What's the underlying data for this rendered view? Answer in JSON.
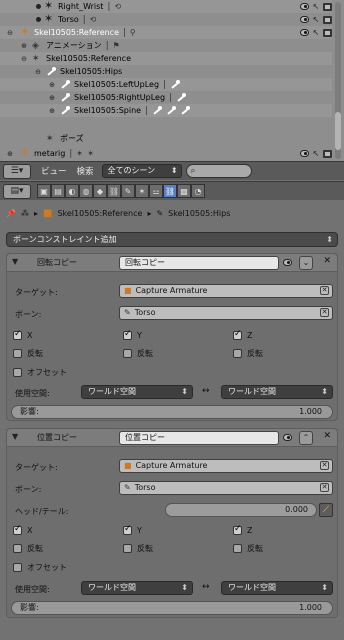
{
  "outliner": {
    "rows": [
      {
        "label": "Right_Wrist",
        "sep": "|"
      },
      {
        "label": "Torso",
        "sep": "|"
      },
      {
        "label": "Skel10505:Reference",
        "sep": "|"
      },
      {
        "label": "アニメーション",
        "sep": "|"
      },
      {
        "label": "Skel10505:Reference"
      },
      {
        "label": "Skel10505:Hips",
        "sep": "|"
      },
      {
        "label": "Skel10505:LeftUpLeg",
        "sep": "|"
      },
      {
        "label": "Skel10505:RightUpLeg",
        "sep": "|"
      },
      {
        "label": "Skel10505:Spine",
        "sep": "|"
      },
      {
        "label": "ポーズ"
      },
      {
        "label": "metarig",
        "sep": "|"
      }
    ],
    "scroll_position": 0.72
  },
  "outliner_header": {
    "menu_view": "ビュー",
    "menu_search": "検索",
    "display_mode": "全てのシーン",
    "search_placeholder": ""
  },
  "properties": {
    "breadcrumb": {
      "armature": "Skel10505:Reference",
      "bone": "Skel10505:Hips"
    },
    "add_constraint_label": "ボーンコンストレイント追加",
    "constraints": [
      {
        "type_label": "回転コピー",
        "name": "回転コピー",
        "target_label": "ターゲット:",
        "target_value": "Capture Armature",
        "bone_label": "ボーン:",
        "bone_value": "Torso",
        "axes": [
          {
            "label": "X",
            "checked": true
          },
          {
            "label": "Y",
            "checked": true
          },
          {
            "label": "Z",
            "checked": true
          }
        ],
        "invert": [
          {
            "label": "反転",
            "checked": false
          },
          {
            "label": "反転",
            "checked": false
          },
          {
            "label": "反転",
            "checked": false
          }
        ],
        "offset_label": "オフセット",
        "offset_checked": false,
        "space_label": "使用空間:",
        "owner_space": "ワールド空間",
        "target_space": "ワールド空間",
        "influence_label": "影響:",
        "influence_value": "1.000"
      },
      {
        "type_label": "位置コピー",
        "name": "位置コピー",
        "target_label": "ターゲット:",
        "target_value": "Capture Armature",
        "bone_label": "ボーン:",
        "bone_value": "Torso",
        "headtail_label": "ヘッド/テール:",
        "headtail_value": "0.000",
        "axes": [
          {
            "label": "X",
            "checked": true
          },
          {
            "label": "Y",
            "checked": true
          },
          {
            "label": "Z",
            "checked": true
          }
        ],
        "invert": [
          {
            "label": "反転",
            "checked": false
          },
          {
            "label": "反転",
            "checked": false
          },
          {
            "label": "反転",
            "checked": false
          }
        ],
        "offset_label": "オフセット",
        "offset_checked": false,
        "space_label": "使用空間:",
        "owner_space": "ワールド空間",
        "target_space": "ワールド空間",
        "influence_label": "影響:",
        "influence_value": "1.000"
      }
    ]
  },
  "colors": {
    "accent_blue": "#5680c2",
    "armature_orange": "#d07a1e"
  }
}
